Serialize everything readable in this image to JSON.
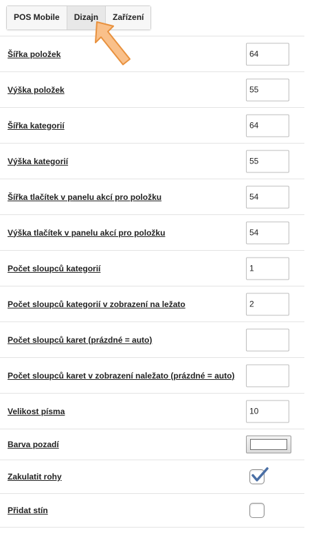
{
  "tabs": [
    {
      "label": "POS Mobile",
      "active": false
    },
    {
      "label": "Dizajn",
      "active": true
    },
    {
      "label": "Zařízení",
      "active": false
    }
  ],
  "settings": {
    "item_width": {
      "label": "Šířka položek",
      "value": "64"
    },
    "item_height": {
      "label": "Výška položek",
      "value": "55"
    },
    "category_width": {
      "label": "Šířka kategorií",
      "value": "64"
    },
    "category_height": {
      "label": "Výška kategorií",
      "value": "55"
    },
    "action_button_width": {
      "label": "Šířka tlačítek v panelu akcí pro položku",
      "value": "54"
    },
    "action_button_height": {
      "label": "Výška tlačítek v panelu akcí pro položku",
      "value": "54"
    },
    "category_columns": {
      "label": "Počet sloupců kategorií",
      "value": "1"
    },
    "category_columns_landscape": {
      "label": "Počet sloupců kategorií v zobrazení na ležato",
      "value": "2"
    },
    "card_columns": {
      "label": "Počet sloupců karet (prázdné = auto)",
      "value": ""
    },
    "card_columns_landscape": {
      "label": "Počet sloupců karet v zobrazení naležato (prázdné = auto)",
      "value": ""
    },
    "font_size": {
      "label": "Velikost písma",
      "value": "10"
    },
    "background_color": {
      "label": "Barva pozadí",
      "value": "#ffffff"
    },
    "rounded_corners": {
      "label": "Zakulatit rohy",
      "checked": true
    },
    "add_shadow": {
      "label": "Přidat stín",
      "checked": false
    }
  },
  "colors": {
    "arrow_fill": "#f9c08a",
    "arrow_stroke": "#e8913e",
    "check_color": "#4a6fa5"
  }
}
